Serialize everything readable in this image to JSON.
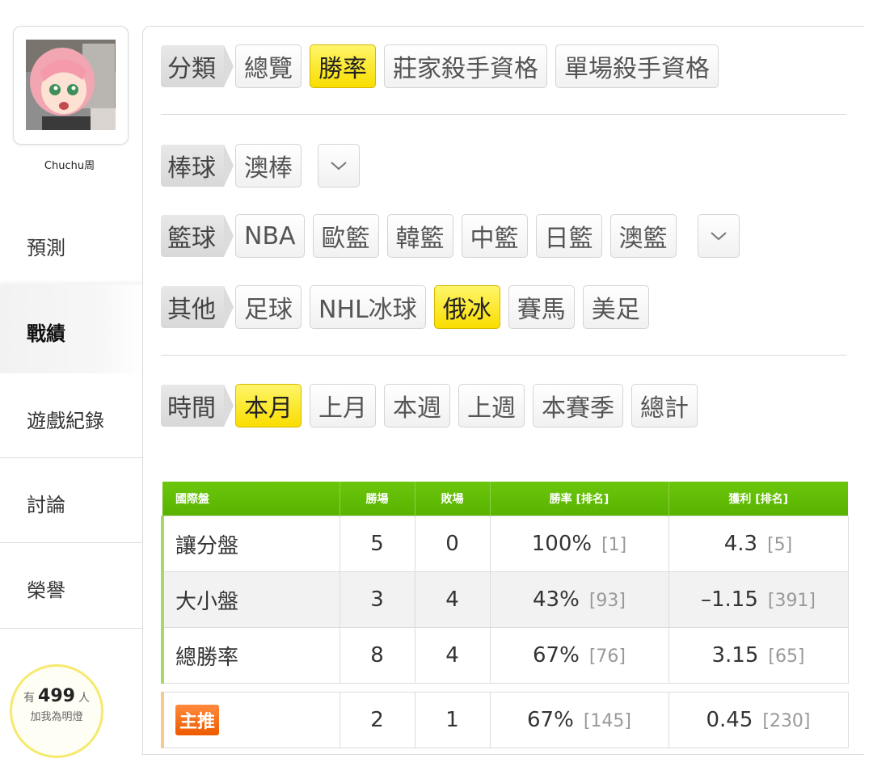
{
  "user": {
    "name": "Chuchu周",
    "fans_prefix": "有",
    "fans_count": "499",
    "fans_suffix": "人",
    "fans_caption": "加我為明燈"
  },
  "nav": [
    "預測",
    "戰績",
    "遊戲紀錄",
    "討論",
    "榮譽"
  ],
  "active_nav": "戰績",
  "filters": {
    "category": {
      "label": "分類",
      "items": [
        "總覽",
        "勝率",
        "莊家殺手資格",
        "單場殺手資格"
      ],
      "active": "勝率"
    },
    "baseball": {
      "label": "棒球",
      "items": [
        "澳棒"
      ]
    },
    "basketball": {
      "label": "籃球",
      "items": [
        "NBA",
        "歐籃",
        "韓籃",
        "中籃",
        "日籃",
        "澳籃"
      ]
    },
    "other": {
      "label": "其他",
      "items": [
        "足球",
        "NHL冰球",
        "俄冰",
        "賽馬",
        "美足"
      ],
      "active": "俄冰"
    },
    "time": {
      "label": "時間",
      "items": [
        "本月",
        "上月",
        "本週",
        "上週",
        "本賽季",
        "總計"
      ],
      "active": "本月"
    }
  },
  "table": {
    "headers": [
      "國際盤",
      "勝場",
      "敗場",
      "勝率 [排名]",
      "獲利 [排名]"
    ],
    "rows": [
      {
        "type": "讓分盤",
        "wins": "5",
        "losses": "0",
        "rate": "100%",
        "rate_rank": "[1]",
        "profit": "4.3",
        "profit_rank": "[5]"
      },
      {
        "type": "大小盤",
        "wins": "3",
        "losses": "4",
        "rate": "43%",
        "rate_rank": "[93]",
        "profit": "–1.15",
        "profit_rank": "[391]"
      },
      {
        "type": "總勝率",
        "wins": "8",
        "losses": "4",
        "rate": "67%",
        "rate_rank": "[76]",
        "profit": "3.15",
        "profit_rank": "[65]"
      }
    ],
    "main_pick": {
      "badge": "主推",
      "wins": "2",
      "losses": "1",
      "rate": "67%",
      "rate_rank": "[145]",
      "profit": "0.45",
      "profit_rank": "[230]"
    }
  },
  "colors": {
    "active_yellow": "#f9dd00",
    "header_green": "#5fba04",
    "badge_orange": "#f06a12",
    "fans_ring": "#f6e96d"
  }
}
